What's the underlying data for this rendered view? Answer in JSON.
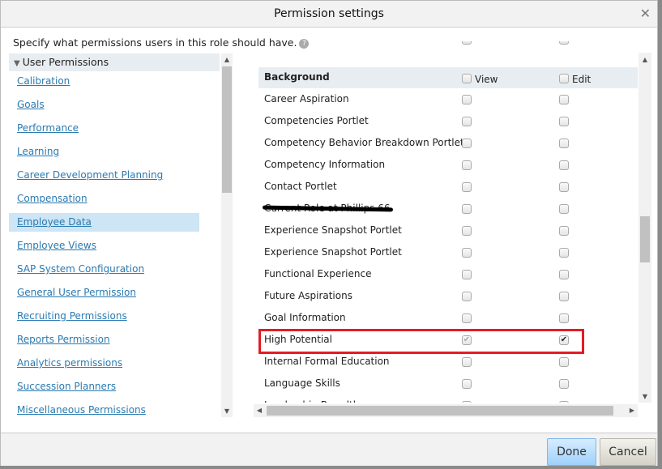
{
  "dialog": {
    "title": "Permission settings",
    "description": "Specify what permissions users in this role should have."
  },
  "left": {
    "header": "User Permissions",
    "items": [
      {
        "label": "Calibration"
      },
      {
        "label": "Goals"
      },
      {
        "label": "Performance"
      },
      {
        "label": "Learning"
      },
      {
        "label": "Career Development Planning"
      },
      {
        "label": "Compensation"
      },
      {
        "label": "Employee Data",
        "selected": true
      },
      {
        "label": "Employee Views"
      },
      {
        "label": "SAP System Configuration"
      },
      {
        "label": "General User Permission"
      },
      {
        "label": "Recruiting Permissions"
      },
      {
        "label": "Reports Permission"
      },
      {
        "label": "Analytics permissions"
      },
      {
        "label": "Succession Planners"
      },
      {
        "label": "Miscellaneous Permissions"
      }
    ]
  },
  "right": {
    "section": "Background",
    "view_label": "View",
    "edit_label": "Edit",
    "rows": [
      {
        "label": "Career Aspiration",
        "view": false,
        "edit": false
      },
      {
        "label": "Competencies Portlet",
        "view": false,
        "edit": false
      },
      {
        "label": "Competency Behavior Breakdown Portlet",
        "view": false,
        "edit": false
      },
      {
        "label": "Competency Information",
        "view": false,
        "edit": false
      },
      {
        "label": "Contact Portlet",
        "view": false,
        "edit": false
      },
      {
        "label": "Current Role at Phillips 66",
        "view": false,
        "edit": false,
        "redacted": true
      },
      {
        "label": "Experience Snapshot Portlet",
        "view": false,
        "edit": false
      },
      {
        "label": "Experience Snapshot Portlet",
        "view": false,
        "edit": false
      },
      {
        "label": "Functional Experience",
        "view": false,
        "edit": false
      },
      {
        "label": "Future Aspirations",
        "view": false,
        "edit": false
      },
      {
        "label": "Goal Information",
        "view": false,
        "edit": false
      },
      {
        "label": "High Potential",
        "view": true,
        "view_disabled": true,
        "edit": true,
        "highlighted": true
      },
      {
        "label": "Internal Formal Education",
        "view": false,
        "edit": false
      },
      {
        "label": "Language Skills",
        "view": false,
        "edit": false
      },
      {
        "label": "Leadership Breadth",
        "view": false,
        "edit": false
      }
    ]
  },
  "footer": {
    "done": "Done",
    "cancel": "Cancel"
  },
  "colors": {
    "highlight": "#e41c24",
    "link": "#2a7ab0",
    "selected": "#cde5f4"
  }
}
